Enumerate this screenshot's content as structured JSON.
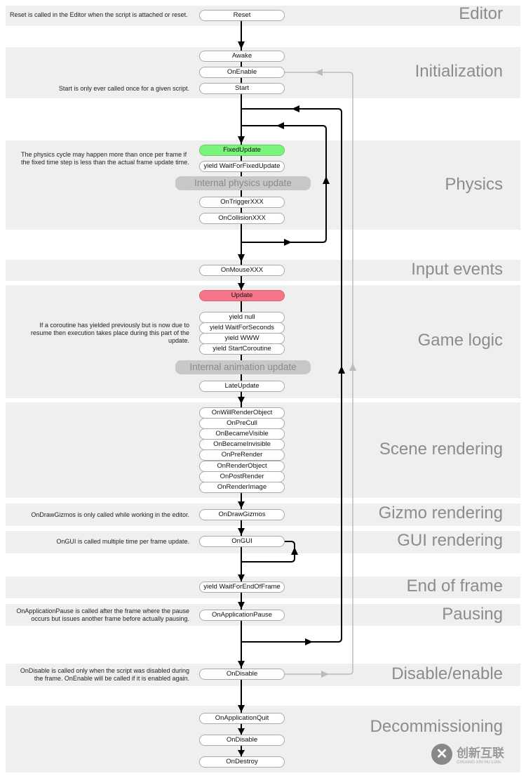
{
  "sections": [
    {
      "title": "Editor"
    },
    {
      "title": "Initialization"
    },
    {
      "title": "Physics"
    },
    {
      "title": "Input events"
    },
    {
      "title": "Game logic"
    },
    {
      "title": "Scene rendering"
    },
    {
      "title": "Gizmo rendering"
    },
    {
      "title": "GUI rendering"
    },
    {
      "title": "End of frame"
    },
    {
      "title": "Pausing"
    },
    {
      "title": "Disable/enable"
    },
    {
      "title": "Decommissioning"
    }
  ],
  "nodes": [
    {
      "label": "Reset",
      "style": "normal"
    },
    {
      "label": "Awake",
      "style": "normal"
    },
    {
      "label": "OnEnable",
      "style": "normal"
    },
    {
      "label": "Start",
      "style": "normal"
    },
    {
      "label": "FixedUpdate",
      "style": "green"
    },
    {
      "label": "yield WaitForFixedUpdate",
      "style": "normal"
    },
    {
      "label": "Internal physics update",
      "style": "internal"
    },
    {
      "label": "OnTriggerXXX",
      "style": "normal"
    },
    {
      "label": "OnCollisionXXX",
      "style": "normal"
    },
    {
      "label": "OnMouseXXX",
      "style": "normal"
    },
    {
      "label": "Update",
      "style": "pink"
    },
    {
      "label": "yield null",
      "style": "normal"
    },
    {
      "label": "yield WaitForSeconds",
      "style": "normal"
    },
    {
      "label": "yield WWW",
      "style": "normal"
    },
    {
      "label": "yield StartCoroutine",
      "style": "normal"
    },
    {
      "label": "Internal animation update",
      "style": "internal"
    },
    {
      "label": "LateUpdate",
      "style": "normal"
    },
    {
      "label": "OnWillRenderObject",
      "style": "normal"
    },
    {
      "label": "OnPreCull",
      "style": "normal"
    },
    {
      "label": "OnBecameVisible",
      "style": "normal"
    },
    {
      "label": "OnBecameInvisible",
      "style": "normal"
    },
    {
      "label": "OnPreRender",
      "style": "normal"
    },
    {
      "label": "OnRenderObject",
      "style": "normal"
    },
    {
      "label": "OnPostRender",
      "style": "normal"
    },
    {
      "label": "OnRenderImage",
      "style": "normal"
    },
    {
      "label": "OnDrawGizmos",
      "style": "normal"
    },
    {
      "label": "OnGUI",
      "style": "normal"
    },
    {
      "label": "yield WaitForEndOfFrame",
      "style": "normal"
    },
    {
      "label": "OnApplicationPause",
      "style": "normal"
    },
    {
      "label": "OnDisable",
      "style": "normal"
    },
    {
      "label": "OnApplicationQuit",
      "style": "normal"
    },
    {
      "label": "OnDisable",
      "style": "normal"
    },
    {
      "label": "OnDestroy",
      "style": "normal"
    }
  ],
  "notes": {
    "reset": "Reset is called in the Editor when the script is attached or reset.",
    "start": "Start is only ever called once for a given script.",
    "physics": "The physics cycle may happen more than once per frame if the fixed time step is less than the actual frame update time.",
    "coroutine": "If a coroutine has yielded previously but is now due to resume then execution takes place during this part of the update.",
    "gizmos": "OnDrawGizmos is only called while working in the editor.",
    "gui": "OnGUI is called multiple time per frame update.",
    "pause": "OnApplicationPause is called after the frame where the pause occurs but issues another frame before actually pausing.",
    "disable": "OnDisable is called only when the script was disabled during the frame. OnEnable will be called if it is enabled again."
  },
  "colors": {
    "fixed_update": "#7bf47b",
    "update": "#f7758a",
    "band": "#efefef",
    "internal": "#c8c8c8"
  },
  "watermark": {
    "text": "创新互联",
    "sub": "CHUANG XIN HU LIAN"
  }
}
